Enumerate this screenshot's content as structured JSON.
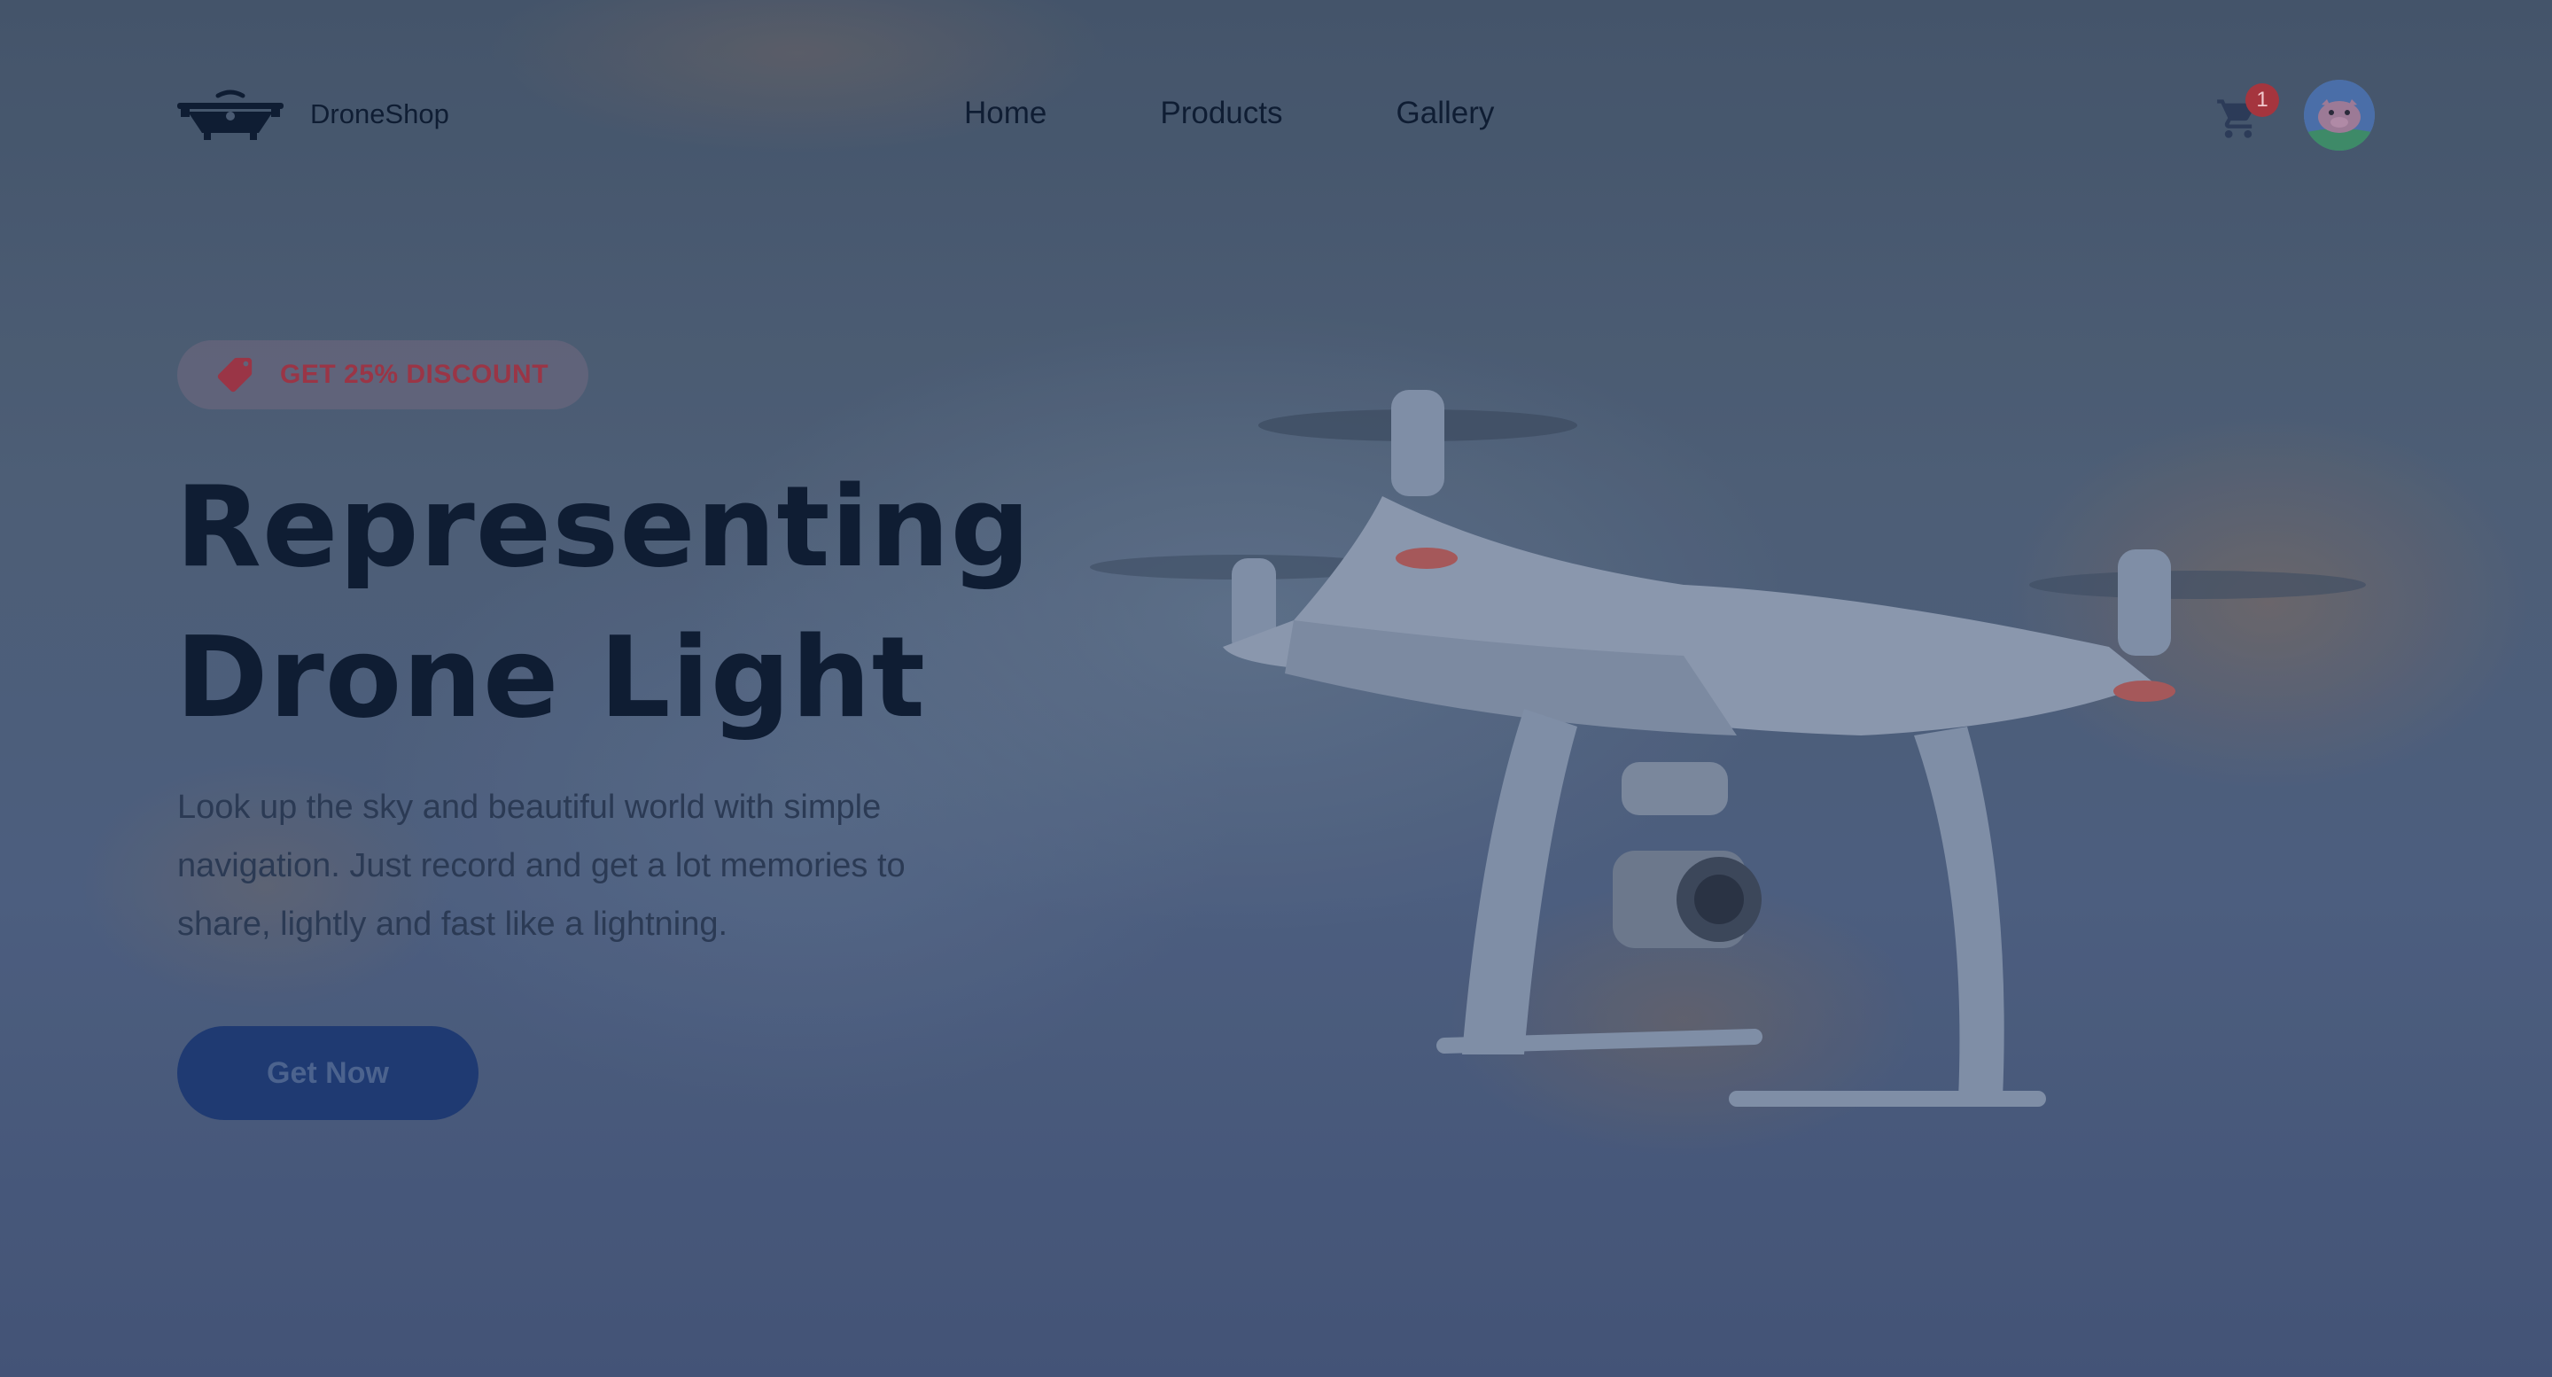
{
  "brand": {
    "name": "DroneShop"
  },
  "nav": {
    "items": [
      {
        "label": "Home"
      },
      {
        "label": "Products"
      },
      {
        "label": "Gallery"
      }
    ]
  },
  "cart": {
    "count": "1"
  },
  "hero": {
    "badge": "GET 25% DISCOUNT",
    "headline": [
      "Representing",
      "Drone Light"
    ],
    "description": "Look up the sky and beautiful world with simple navigation. Just record and get a lot memories to share, lightly and fast like a lightning.",
    "cta_label": "Get Now"
  },
  "colors": {
    "overlay": "#4a5a72",
    "heading": "#0f1d33",
    "accent_button": "#1f3a72",
    "badge_text": "#9a3546",
    "cart_badge": "#a5353e"
  }
}
